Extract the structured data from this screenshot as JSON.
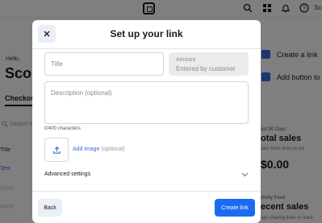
{
  "background": {
    "topbar": {
      "user_label": "Sco",
      "icons": [
        "square-logo-icon",
        "search-icon",
        "apps-grid-icon",
        "bell-icon",
        "help-icon"
      ]
    },
    "greeting": "Hello,",
    "name": "Scon",
    "tab": "Checkout",
    "search_placeholder": "Search lin",
    "table": {
      "column_title": "Title",
      "rows": [
        "Test"
      ]
    },
    "right_actions": [
      "Create a link",
      "Add button to w"
    ],
    "stats": {
      "subtitle": "ast 90 Days",
      "title": "otal sales",
      "note": "ales from links to tra",
      "value": "$0.00"
    },
    "feed": {
      "subtitle": "ctivity Feed",
      "title": "ecent sales",
      "note": "tart sharing links to track"
    }
  },
  "modal": {
    "title": "Set up your link",
    "title_placeholder": "Title",
    "amount_label": "Amount",
    "amount_placeholder": "Entered by customer",
    "description_placeholder": "Description (optional)",
    "char_count": "0/400 characters",
    "add_image_label": "Add image",
    "add_image_optional": "(optional)",
    "advanced_settings": "Advanced settings",
    "back_label": "Back",
    "create_label": "Create link"
  },
  "colors": {
    "accent": "#1a6bf0",
    "link": "#3a6be0",
    "annotation": "#e8321e",
    "overlay": "rgba(0,0,0,0.5)"
  }
}
